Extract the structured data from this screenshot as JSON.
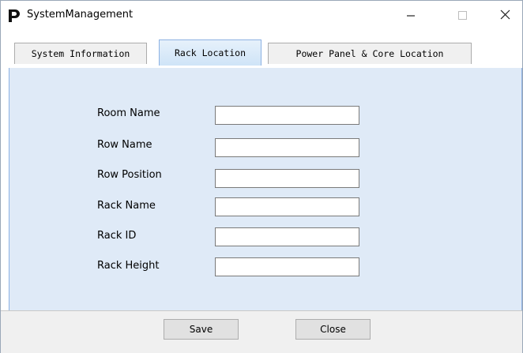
{
  "window": {
    "title": "SystemManagement",
    "icons": {
      "app": "p-logo-icon",
      "minimize": "minimize-icon",
      "maximize": "maximize-icon",
      "close": "close-icon"
    }
  },
  "tabs": [
    {
      "label": "System Information",
      "active": false
    },
    {
      "label": "Rack Location",
      "active": true
    },
    {
      "label": "Power Panel & Core Location",
      "active": false
    }
  ],
  "form": {
    "fields": [
      {
        "label": "Room Name",
        "value": ""
      },
      {
        "label": "Row Name",
        "value": ""
      },
      {
        "label": "Row Position",
        "value": ""
      },
      {
        "label": "Rack Name",
        "value": ""
      },
      {
        "label": "Rack ID",
        "value": ""
      },
      {
        "label": "Rack Height",
        "value": ""
      }
    ]
  },
  "buttons": {
    "save": "Save",
    "close": "Close"
  },
  "colors": {
    "panel": "#dfeaf7",
    "active_tab": "#cfe4f7",
    "border_accent": "#8db2e3",
    "footer": "#f0f0f0"
  }
}
